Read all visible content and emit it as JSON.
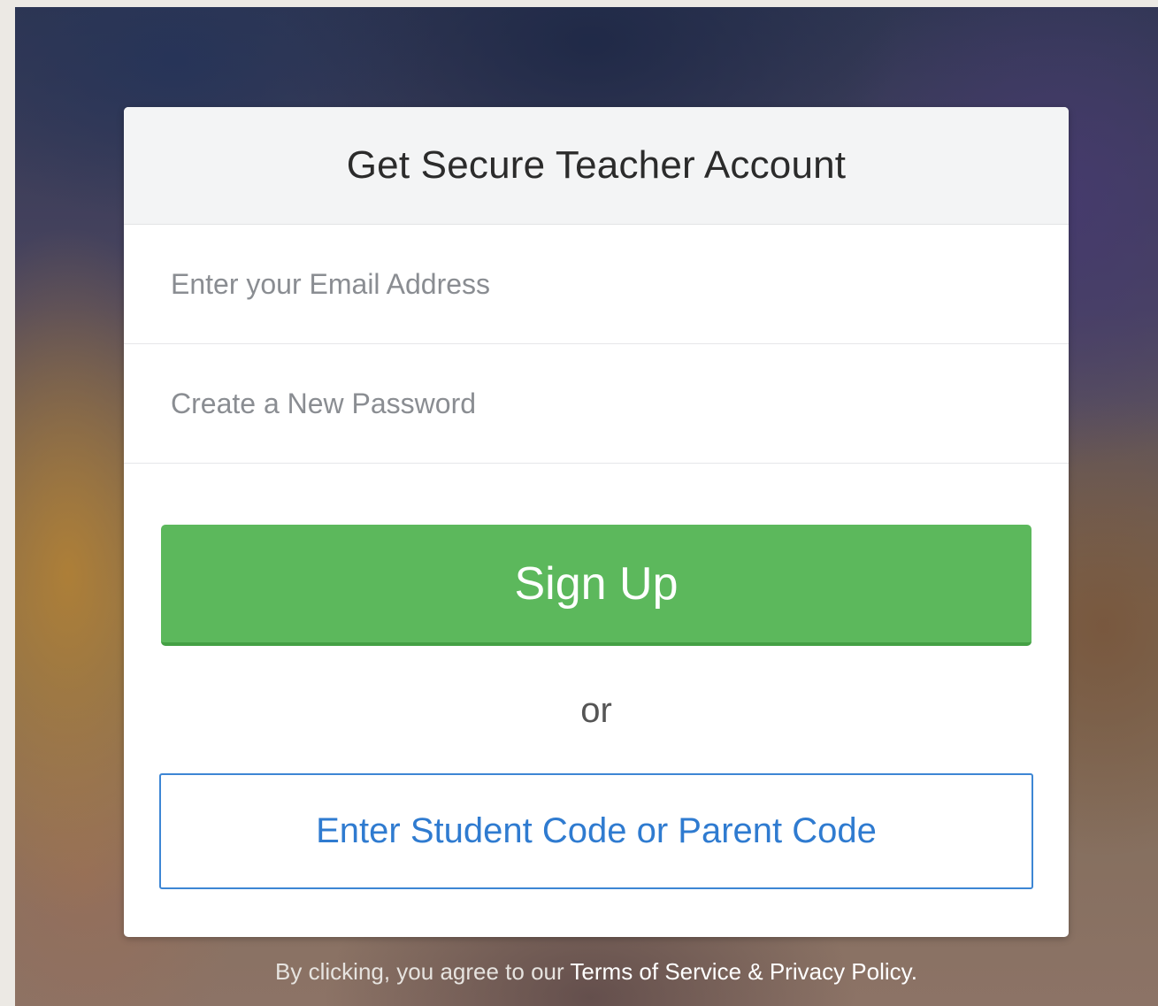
{
  "signup_card": {
    "title": "Get Secure Teacher Account",
    "email_placeholder": "Enter your Email Address",
    "password_placeholder": "Create a New Password",
    "signup_label": "Sign Up",
    "or_label": "or",
    "code_button_label": "Enter Student Code or Parent Code"
  },
  "footer": {
    "prefix": "By clicking, you agree to our ",
    "terms_link": "Terms of Service",
    "separator": " & ",
    "privacy_link": "Privacy Policy",
    "suffix": "."
  },
  "colors": {
    "primary_green": "#5cb85c",
    "link_blue": "#2f7bd0",
    "header_bg": "#f3f4f5"
  }
}
